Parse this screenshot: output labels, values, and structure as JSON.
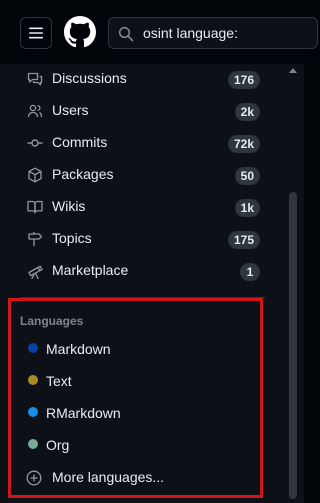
{
  "search": {
    "query": "osint language:"
  },
  "nav": [
    {
      "label": "Discussions",
      "count": "176",
      "icon": "comment-discussion-icon"
    },
    {
      "label": "Users",
      "count": "2k",
      "icon": "people-icon"
    },
    {
      "label": "Commits",
      "count": "72k",
      "icon": "git-commit-icon"
    },
    {
      "label": "Packages",
      "count": "50",
      "icon": "package-icon"
    },
    {
      "label": "Wikis",
      "count": "1k",
      "icon": "book-icon"
    },
    {
      "label": "Topics",
      "count": "175",
      "icon": "milestone-icon"
    },
    {
      "label": "Marketplace",
      "count": "1",
      "icon": "telescope-icon"
    }
  ],
  "languages": {
    "title": "Languages",
    "items": [
      {
        "label": "Markdown",
        "color": "#083fa1"
      },
      {
        "label": "Text",
        "color": "#a88a27"
      },
      {
        "label": "RMarkdown",
        "color": "#198ce7"
      },
      {
        "label": "Org",
        "color": "#77aa99"
      }
    ],
    "more_label": "More languages..."
  },
  "colors": {
    "highlight_border": "#d0161d",
    "count_badge": "#30363d",
    "background": "#0d1117"
  }
}
